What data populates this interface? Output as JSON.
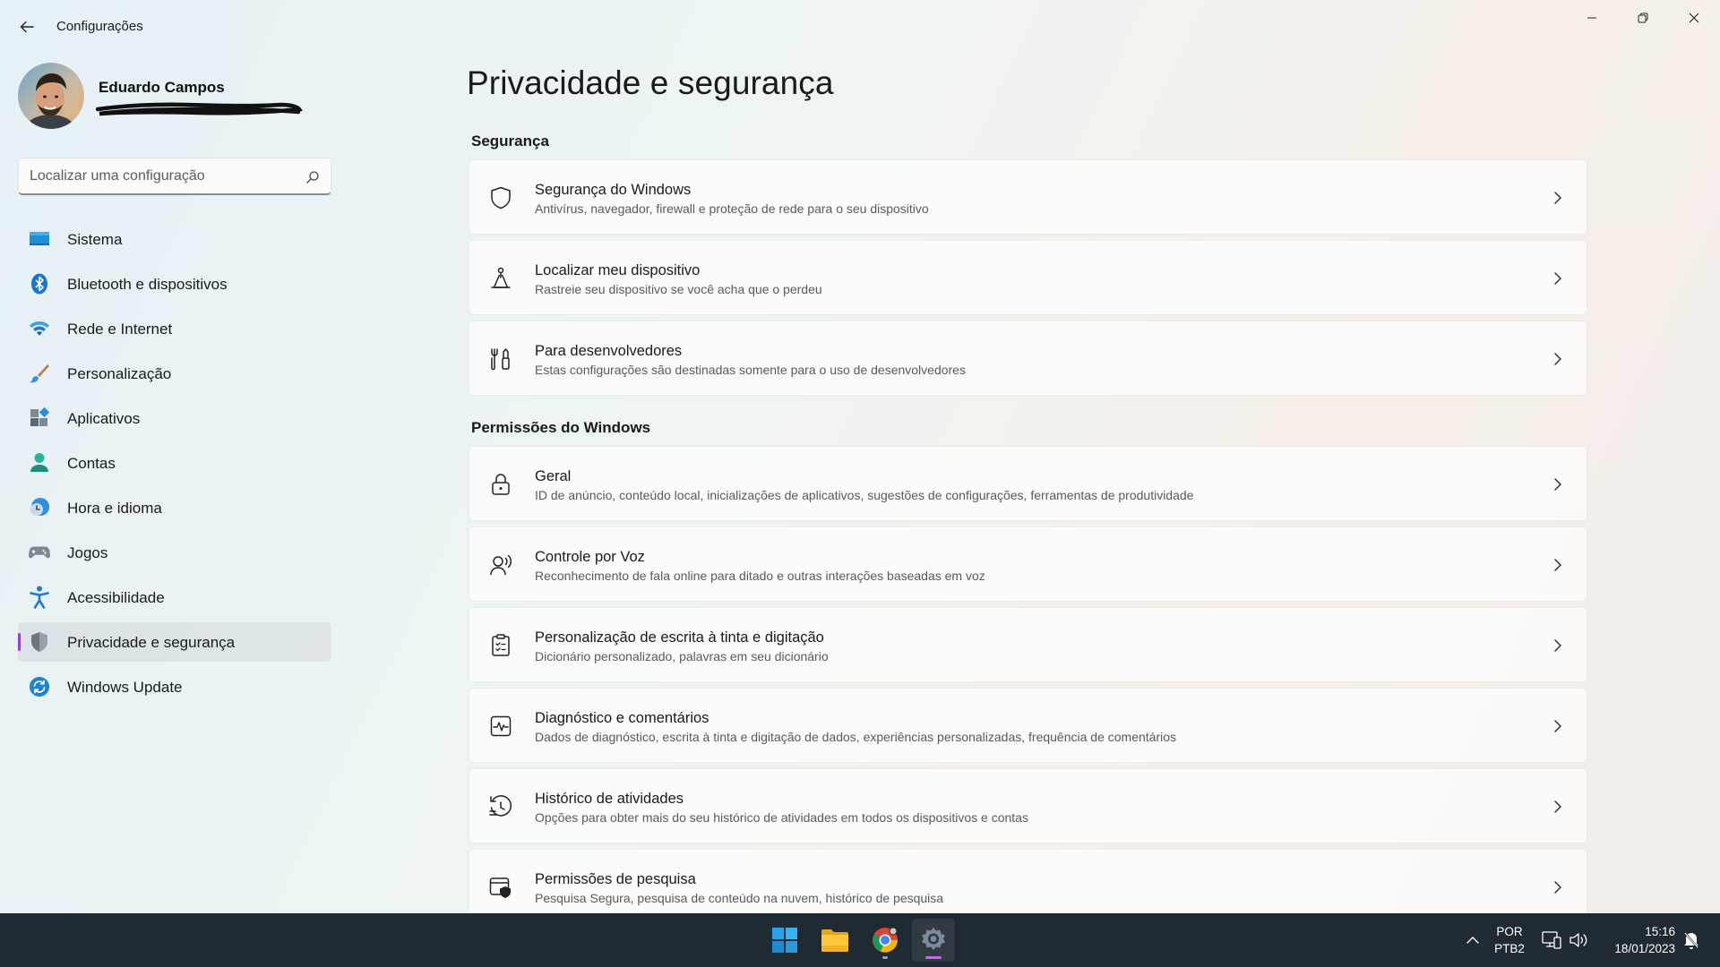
{
  "window": {
    "title": "Configurações",
    "controls": [
      "minimize-icon",
      "maximize-icon",
      "close-icon"
    ]
  },
  "profile": {
    "name": "Eduardo Campos"
  },
  "search": {
    "placeholder": "Localizar uma configuração"
  },
  "sidebar": {
    "items": [
      {
        "label": "Sistema",
        "icon": "system-icon"
      },
      {
        "label": "Bluetooth e dispositivos",
        "icon": "bluetooth-icon"
      },
      {
        "label": "Rede e Internet",
        "icon": "wifi-icon"
      },
      {
        "label": "Personalização",
        "icon": "brush-icon"
      },
      {
        "label": "Aplicativos",
        "icon": "apps-icon"
      },
      {
        "label": "Contas",
        "icon": "account-icon"
      },
      {
        "label": "Hora e idioma",
        "icon": "clock-globe-icon"
      },
      {
        "label": "Jogos",
        "icon": "gamepad-icon"
      },
      {
        "label": "Acessibilidade",
        "icon": "accessibility-icon"
      },
      {
        "label": "Privacidade e segurança",
        "icon": "shield-icon",
        "selected": true
      },
      {
        "label": "Windows Update",
        "icon": "update-icon"
      }
    ]
  },
  "main": {
    "title": "Privacidade e segurança",
    "sections": [
      {
        "title": "Segurança",
        "items": [
          {
            "title": "Segurança do Windows",
            "desc": "Antivírus, navegador, firewall e proteção de rede para o seu dispositivo",
            "icon": "shield-outline-icon"
          },
          {
            "title": "Localizar meu dispositivo",
            "desc": "Rastreie seu dispositivo se você acha que o perdeu",
            "icon": "find-device-icon"
          },
          {
            "title": "Para desenvolvedores",
            "desc": "Estas configurações são destinadas somente para o uso de desenvolvedores",
            "icon": "developer-tools-icon"
          }
        ]
      },
      {
        "title": "Permissões do Windows",
        "items": [
          {
            "title": "Geral",
            "desc": "ID de anúncio, conteúdo local, inicializações de aplicativos, sugestões de configurações, ferramentas de produtividade",
            "icon": "lock-icon"
          },
          {
            "title": "Controle por Voz",
            "desc": "Reconhecimento de fala online para ditado e outras interações baseadas em voz",
            "icon": "voice-icon"
          },
          {
            "title": "Personalização de escrita à tinta e digitação",
            "desc": "Dicionário personalizado, palavras em seu dicionário",
            "icon": "clipboard-list-icon"
          },
          {
            "title": "Diagnóstico e comentários",
            "desc": "Dados de diagnóstico, escrita à tinta e digitação de dados, experiências personalizadas, frequência de comentários",
            "icon": "diagnostics-icon"
          },
          {
            "title": "Histórico de atividades",
            "desc": "Opções para obter mais do seu histórico de atividades em todos os dispositivos e contas",
            "icon": "history-icon"
          },
          {
            "title": "Permissões de pesquisa",
            "desc": "Pesquisa Segura, pesquisa de conteúdo na nuvem, histórico de pesquisa",
            "icon": "search-permissions-icon"
          }
        ]
      }
    ]
  },
  "taskbar": {
    "apps": [
      "windows-start-icon",
      "file-explorer-icon",
      "chrome-icon",
      "settings-icon"
    ],
    "language": {
      "line1": "POR",
      "line2": "PTB2"
    },
    "time": "15:16",
    "date": "18/01/2023"
  },
  "colors": {
    "accent": "#8e44d8",
    "taskbar": "#202a33",
    "windows_blue": "#1a8ad4"
  }
}
